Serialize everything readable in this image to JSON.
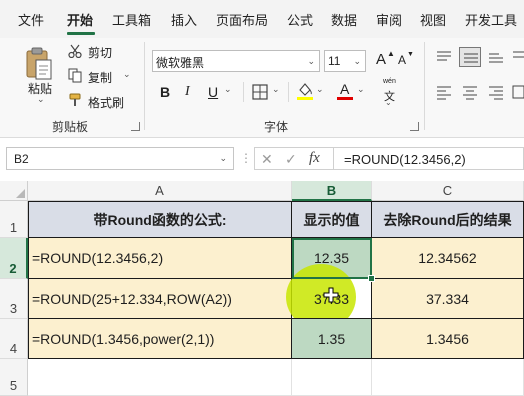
{
  "menu": {
    "items": [
      "文件",
      "开始",
      "工具箱",
      "插入",
      "页面布局",
      "公式",
      "数据",
      "审阅",
      "视图",
      "开发工具"
    ],
    "active_index": 1
  },
  "ribbon": {
    "clipboard": {
      "paste_label": "粘贴",
      "cut_label": "剪切",
      "copy_label": "复制",
      "format_painter_label": "格式刷",
      "group_label": "剪贴板"
    },
    "font": {
      "font_name": "微软雅黑",
      "font_size": "11",
      "group_label": "字体",
      "bold_label": "B",
      "italic_label": "I",
      "underline_label": "U",
      "grow_label": "A",
      "shrink_label": "A",
      "font_color_label": "A",
      "phonetic_label": "文",
      "phonetic_top": "wén",
      "fill_color": "#ffff00",
      "font_color": "#e00000"
    }
  },
  "formula_bar": {
    "name_box": "B2",
    "formula": "=ROUND(12.3456,2)",
    "fx_label": "fx"
  },
  "sheet": {
    "columns": [
      "A",
      "B",
      "C"
    ],
    "rows": [
      "1",
      "2",
      "3",
      "4",
      "5"
    ],
    "selected_cell": "B2",
    "header_row": [
      "带Round函数的公式:",
      "显示的值",
      "去除Round后的结果"
    ],
    "data": [
      [
        "=ROUND(12.3456,2)",
        "12.35",
        "12.34562"
      ],
      [
        "=ROUND(25+12.334,ROW(A2))",
        "37.33",
        "37.334"
      ],
      [
        "=ROUND(1.3456,power(2,1))",
        "1.35",
        "1.3456"
      ]
    ],
    "colors": {
      "header_fill": "#d9dde7",
      "data_fill": "#fcf0cf",
      "value_column_fill": "#bdd9c2",
      "selection": "#217346"
    }
  }
}
